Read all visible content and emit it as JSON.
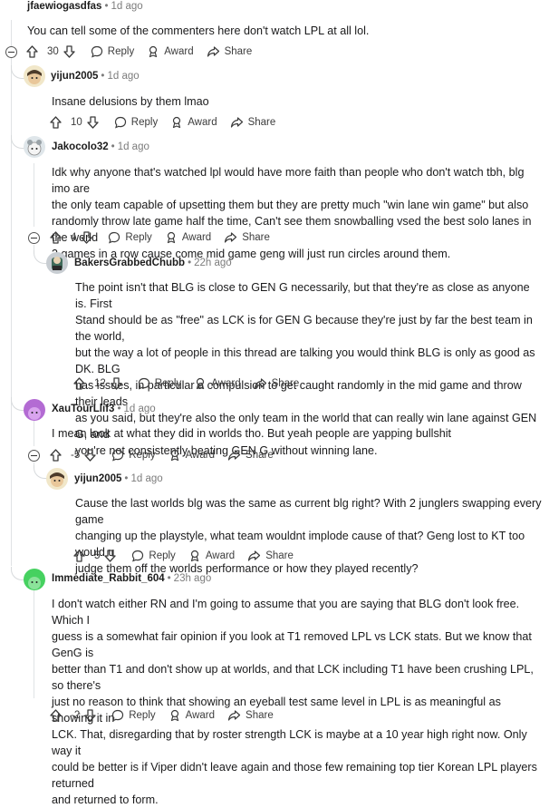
{
  "comments": [
    {
      "author": "jfaewiogasdfas",
      "time": "1d ago",
      "body": [
        "You can tell some of the commenters here don't watch LPL at all lol."
      ],
      "score": "30",
      "reply": "Reply",
      "award": "Award",
      "share": "Share"
    },
    {
      "author": "yijun2005",
      "time": "1d ago",
      "body": [
        "Insane delusions by them lmao"
      ],
      "score": "10",
      "reply": "Reply",
      "award": "Award",
      "share": "Share"
    },
    {
      "author": "Jakocolo32",
      "time": "1d ago",
      "body": [
        "Idk why anyone that's watched lpl would have more faith than people who don't watch tbh, blg imo are",
        "the only team capable of upsetting them but they are pretty much \"win lane win game\" but also",
        "randomly throw late game half the time, Can't see them snowballing vsed the best solo lanes in the world",
        "3 games in a row cause come mid game geng will just run circles around them."
      ],
      "score": "4",
      "reply": "Reply",
      "award": "Award",
      "share": "Share"
    },
    {
      "author": "BakersGrabbedChubb",
      "time": "22h ago",
      "body": [
        "The point isn't that BLG is close to GEN G necessarily, but that they're as close as anyone is. First",
        "Stand should be as \"free\" as LCK is for GEN G because they're just by far the best team in the world,",
        "but the way a lot of people in this thread are talking you would think BLG is only as good as DK. BLG",
        "has issues, in particular a compulsion to get caught randomly in the mid game and throw their leads",
        "as you said, but they're also the only team in the world that can really win lane against GEN G, and",
        "you're not consistently beating GEN G without winning lane."
      ],
      "score": "12",
      "reply": "Reply",
      "award": "Award",
      "share": "Share"
    },
    {
      "author": "XauTourLlif3",
      "time": "1d ago",
      "body": [
        "I mean look at what they did in worlds tho. But yeah people are yapping bullshit"
      ],
      "score": "-5",
      "reply": "Reply",
      "award": "Award",
      "share": "Share"
    },
    {
      "author": "yijun2005",
      "time": "1d ago",
      "body": [
        "Cause the last worlds blg was the same as current blg right? With 2 junglers swapping every game",
        "changing up the playstyle, what team wouldnt implode cause of that? Geng lost to KT too would u",
        "judge them off the worlds performance or how they played recently?"
      ],
      "score": "5",
      "reply": "Reply",
      "award": "Award",
      "share": "Share"
    },
    {
      "author": "Immediate_Rabbit_604",
      "time": "23h ago",
      "body": [
        "I don't watch either RN and I'm going to assume that you are saying that BLG don't look free. Which I",
        "guess is a somewhat fair opinion if you look at T1 removed LPL vs LCK stats. But we know that GenG is",
        "better than T1 and don't show up at worlds, and that LCK including T1 have been crushing LPL, so there's",
        "just no reason to think that showing an eyeball test same level in LPL is as meaningful as showing it in",
        "LCK. That, disregarding that by roster strength LCK is maybe at a 10 year high right now. Only way it",
        "could be better is if Viper didn't leave again and those few remaining top tier Korean LPL players returned",
        "and returned to form."
      ],
      "score": "-2",
      "reply": "Reply",
      "award": "Award",
      "share": "Share"
    }
  ],
  "colors": {
    "avatar_green": "#46d160",
    "avatar_purple": "#b36bd3",
    "avatar_grey": "#c8cdd2"
  },
  "icons": [
    "upvote-icon",
    "downvote-icon",
    "reply-icon",
    "award-icon",
    "share-icon",
    "collapse-icon"
  ]
}
